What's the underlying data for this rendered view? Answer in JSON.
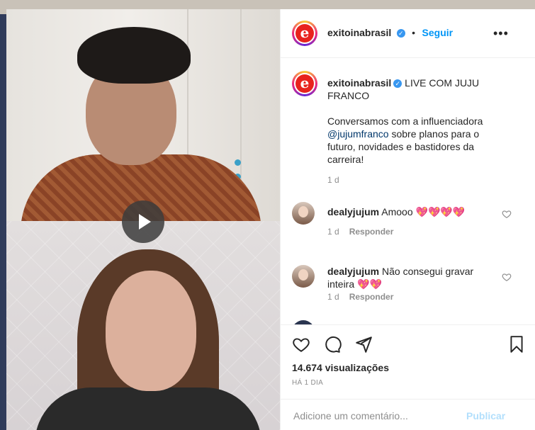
{
  "post": {
    "username": "exitoinabrasil",
    "verified": true,
    "separator": "•",
    "follow_label": "Seguir",
    "more_label": "•••",
    "avatar_letter": "e"
  },
  "caption": {
    "username": "exitoinabrasil",
    "title": "LIVE COM JUJU FRANCO",
    "body_prefix": "Conversamos com a influenciadora ",
    "mention": "@jujumfranco",
    "body_suffix": " sobre planos para o futuro, novidades e bastidores da carreira!",
    "time": "1 d"
  },
  "comments": [
    {
      "username": "dealyjujum",
      "text": "Amooo 💖💖💖💖",
      "time": "1 d",
      "reply_label": "Responder"
    },
    {
      "username": "dealyjujum",
      "text": "Não consegui gravar inteira 💖💖",
      "time": "1 d",
      "reply_label": "Responder"
    }
  ],
  "stats": {
    "views": "14.674 visualizações",
    "posted_ago": "HÁ 1 DIA"
  },
  "composer": {
    "placeholder": "Adicione um comentário...",
    "publish_label": "Publicar"
  },
  "colors": {
    "link": "#0095f6",
    "logo_red": "#e8231d",
    "publish_disabled": "#b2dffc"
  }
}
